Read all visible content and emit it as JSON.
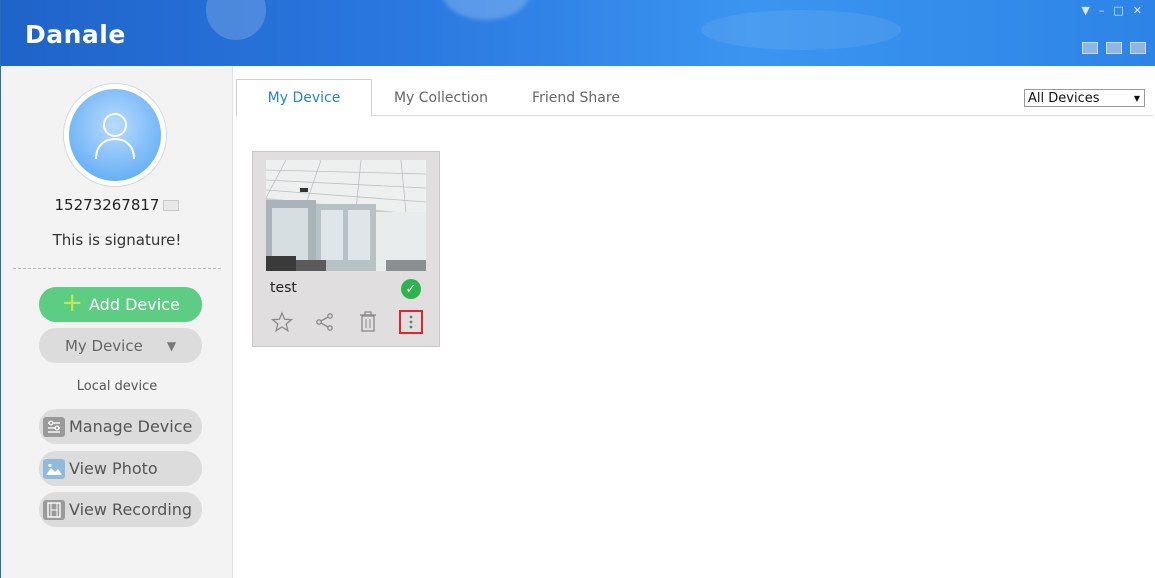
{
  "app": {
    "title": "Danale"
  },
  "window_controls": [
    "▼",
    "–",
    "□",
    "✕"
  ],
  "profile": {
    "phone": "15273267817",
    "signature": "This is signature!"
  },
  "sidebar": {
    "add_device": "Add Device",
    "my_device": "My Device",
    "local_device": "Local device",
    "manage_device": "Manage Device",
    "view_photo": "View Photo",
    "view_recording": "View Recording"
  },
  "tabs": [
    {
      "label": "My Device",
      "active": true
    },
    {
      "label": "My Collection",
      "active": false
    },
    {
      "label": "Friend Share",
      "active": false
    }
  ],
  "filter": {
    "selected": "All Devices"
  },
  "devices": [
    {
      "name": "test",
      "status": "online"
    }
  ],
  "icons": {
    "online": "check-circle-icon",
    "favorite": "star-icon",
    "share": "share-icon",
    "delete": "trash-icon",
    "more": "more-vertical-icon"
  },
  "colors": {
    "header": "#2a78e0",
    "accent_green": "#5ccd82",
    "tab_active_text": "#2a80d8",
    "highlight_border": "#e0262b",
    "online": "#2fb34e"
  }
}
